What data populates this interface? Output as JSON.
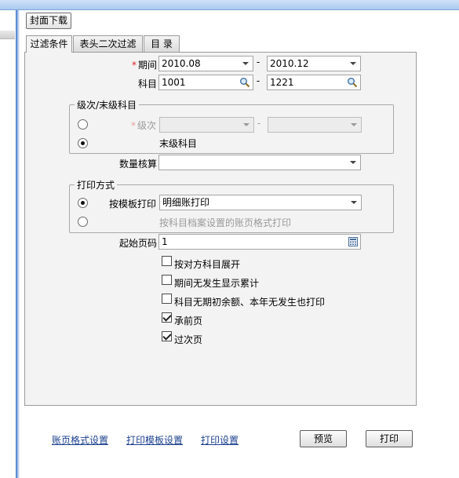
{
  "toolbar": {
    "cover_download": "封面下载"
  },
  "tabs": [
    {
      "label": "过滤条件",
      "active": true
    },
    {
      "label": "表头二次过滤",
      "active": false
    },
    {
      "label": "目 录",
      "active": false
    }
  ],
  "filter": {
    "period": {
      "label": "期间",
      "from": "2010.08",
      "to": "2010.12"
    },
    "subject": {
      "label": "科目",
      "from": "1001",
      "to": "1221"
    },
    "level_group": {
      "title": "级次/末级科目",
      "level_label": "级次",
      "level_from": "",
      "level_to": "",
      "last_level_label": "末级科目",
      "selected": "last_level"
    },
    "quantity_audit": {
      "label": "数量核算",
      "value": ""
    },
    "print_group": {
      "title": "打印方式",
      "template_label": "按模板打印",
      "template_value": "明细账打印",
      "archive_label": "按科目档案设置的账页格式打印",
      "selected": "template"
    },
    "start_page": {
      "label": "起始页码",
      "value": "1"
    },
    "options": [
      {
        "label": "按对方科目展开",
        "checked": false
      },
      {
        "label": "期间无发生显示累计",
        "checked": false
      },
      {
        "label": "科目无期初余额、本年无发生也打印",
        "checked": false
      },
      {
        "label": "承前页",
        "checked": true
      },
      {
        "label": "过次页",
        "checked": true
      }
    ]
  },
  "footer": {
    "links": [
      "账页格式设置",
      "打印模板设置",
      "打印设置"
    ],
    "preview": "预览",
    "print": "打印"
  },
  "colors": {
    "accent": "#3a6fc4",
    "link": "#1b3f8f",
    "required": "#e02020"
  }
}
